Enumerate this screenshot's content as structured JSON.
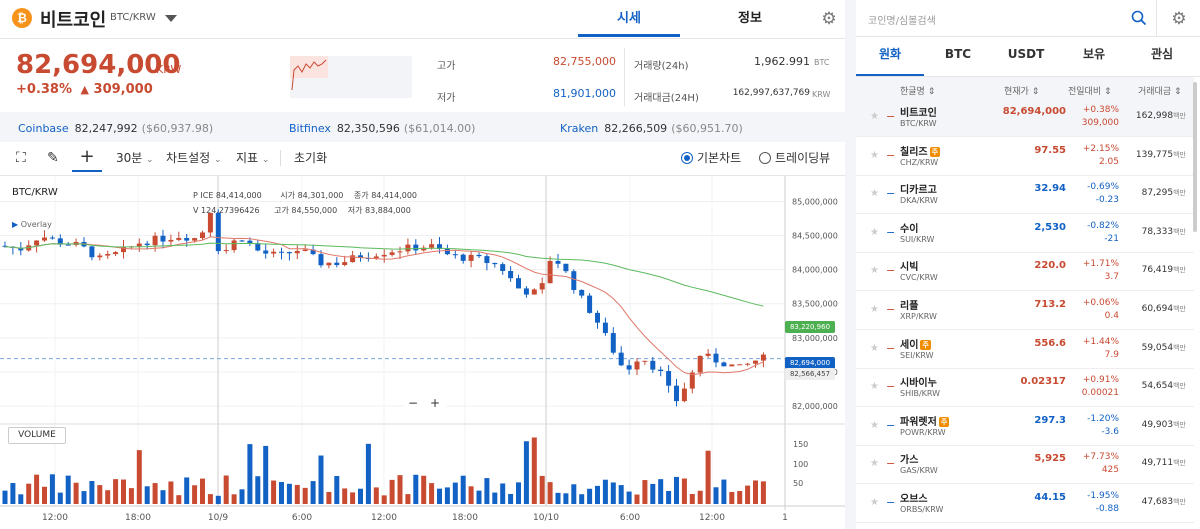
{
  "header": {
    "coin_symbol_glyph": "₿",
    "coin_name": "비트코인",
    "pair": "BTC/KRW",
    "tabs": [
      {
        "label": "시세"
      },
      {
        "label": "정보"
      }
    ]
  },
  "ticker": {
    "price": "82,694,000",
    "unit": "KRW",
    "change_pct": "+0.38%",
    "change_arrow": "▲",
    "change_amt": "309,000",
    "high_label": "고가",
    "high": "82,755,000",
    "low_label": "저가",
    "low": "81,901,000",
    "vol_label": "거래량(24h)",
    "vol": "1,962.991",
    "vol_unit": "BTC",
    "amt_label": "거래대금(24H)",
    "amt": "162,997,637,769",
    "amt_unit": "KRW"
  },
  "exchanges": [
    {
      "name": "Coinbase",
      "price": "82,247,992",
      "usd": "($60,937.98)"
    },
    {
      "name": "Bitfinex",
      "price": "82,350,596",
      "usd": "($61,014.00)"
    },
    {
      "name": "Kraken",
      "price": "82,266,509",
      "usd": "($60,951.70)"
    }
  ],
  "toolbar": {
    "interval": "30분",
    "chart_settings": "차트설정",
    "indicator": "지표",
    "reset": "초기화",
    "basic_chart": "기본차트",
    "tradingview": "트레이딩뷰"
  },
  "chart_data": {
    "type": "candlestick",
    "symbol": "BTC/KRW",
    "ohlc_labels": {
      "pri": "P ICE",
      "pri_val": "84,414,000",
      "open": "시가",
      "open_val": "84,301,000",
      "close": "종가",
      "close_val": "84,414,000",
      "high": "고가",
      "high_val": "84,550,000",
      "low": "저가",
      "low_val": "83,884,000",
      "v_val": "V 124.27396426"
    },
    "overlay_label": "Overlay",
    "y_ticks": [
      "85,000,000",
      "84,500,000",
      "84,000,000",
      "83,500,000",
      "83,000,000",
      "82,500,000",
      "82,000,000"
    ],
    "y_range": [
      81780000,
      85300000
    ],
    "x_ticks": [
      "12:00",
      "18:00",
      "10/9",
      "6:00",
      "12:00",
      "18:00",
      "10/10",
      "6:00",
      "12:00",
      "1"
    ],
    "price_tags": {
      "ma_long": "83,220,960",
      "current": "82,694,000",
      "ma_short": "82,566,457"
    },
    "volume_label": "VOLUME",
    "volume_ticks": [
      "150",
      "100",
      "50"
    ],
    "zoom_minus": "−",
    "zoom_plus": "+",
    "up_color": "#c84a31",
    "down_color": "#1261c4",
    "ma_short_color": "#e0786a",
    "ma_long_color": "#5cba5c"
  },
  "market": {
    "search_placeholder": "코인명/심볼검색",
    "tabs": [
      {
        "label": "원화"
      },
      {
        "label": "BTC"
      },
      {
        "label": "USDT"
      },
      {
        "label": "보유"
      },
      {
        "label": "관심"
      }
    ],
    "columns": {
      "name": "한글명 ⇕",
      "price": "현재가 ⇕",
      "change": "전일대비 ⇕",
      "volume": "거래대금 ⇕"
    },
    "rows": [
      {
        "name": "비트코인",
        "pair": "BTC/KRW",
        "price": "82,694,000",
        "pct": "+0.38%",
        "chg": "309,000",
        "vol": "162,998",
        "unit": "백만",
        "dir": "up",
        "badge": ""
      },
      {
        "name": "칠리즈",
        "pair": "CHZ/KRW",
        "price": "97.55",
        "pct": "+2.15%",
        "chg": "2.05",
        "vol": "139,775",
        "unit": "백만",
        "dir": "up",
        "badge": "주"
      },
      {
        "name": "디카르고",
        "pair": "DKA/KRW",
        "price": "32.94",
        "pct": "-0.69%",
        "chg": "-0.23",
        "vol": "87,295",
        "unit": "백만",
        "dir": "dn",
        "badge": ""
      },
      {
        "name": "수이",
        "pair": "SUI/KRW",
        "price": "2,530",
        "pct": "-0.82%",
        "chg": "-21",
        "vol": "78,333",
        "unit": "백만",
        "dir": "dn",
        "badge": ""
      },
      {
        "name": "시빅",
        "pair": "CVC/KRW",
        "price": "220.0",
        "pct": "+1.71%",
        "chg": "3.7",
        "vol": "76,419",
        "unit": "백만",
        "dir": "up",
        "badge": ""
      },
      {
        "name": "리플",
        "pair": "XRP/KRW",
        "price": "713.2",
        "pct": "+0.06%",
        "chg": "0.4",
        "vol": "60,694",
        "unit": "백만",
        "dir": "up",
        "badge": ""
      },
      {
        "name": "세이",
        "pair": "SEI/KRW",
        "price": "556.6",
        "pct": "+1.44%",
        "chg": "7.9",
        "vol": "59,054",
        "unit": "백만",
        "dir": "up",
        "badge": "주"
      },
      {
        "name": "시바이누",
        "pair": "SHIB/KRW",
        "price": "0.02317",
        "pct": "+0.91%",
        "chg": "0.00021",
        "vol": "54,654",
        "unit": "백만",
        "dir": "up",
        "badge": ""
      },
      {
        "name": "파워렛저",
        "pair": "POWR/KRW",
        "price": "297.3",
        "pct": "-1.20%",
        "chg": "-3.6",
        "vol": "49,903",
        "unit": "백만",
        "dir": "dn",
        "badge": "주"
      },
      {
        "name": "가스",
        "pair": "GAS/KRW",
        "price": "5,925",
        "pct": "+7.73%",
        "chg": "425",
        "vol": "49,711",
        "unit": "백만",
        "dir": "up",
        "badge": ""
      },
      {
        "name": "오브스",
        "pair": "ORBS/KRW",
        "price": "44.15",
        "pct": "-1.95%",
        "chg": "-0.88",
        "vol": "47,683",
        "unit": "백만",
        "dir": "dn",
        "badge": ""
      }
    ]
  }
}
